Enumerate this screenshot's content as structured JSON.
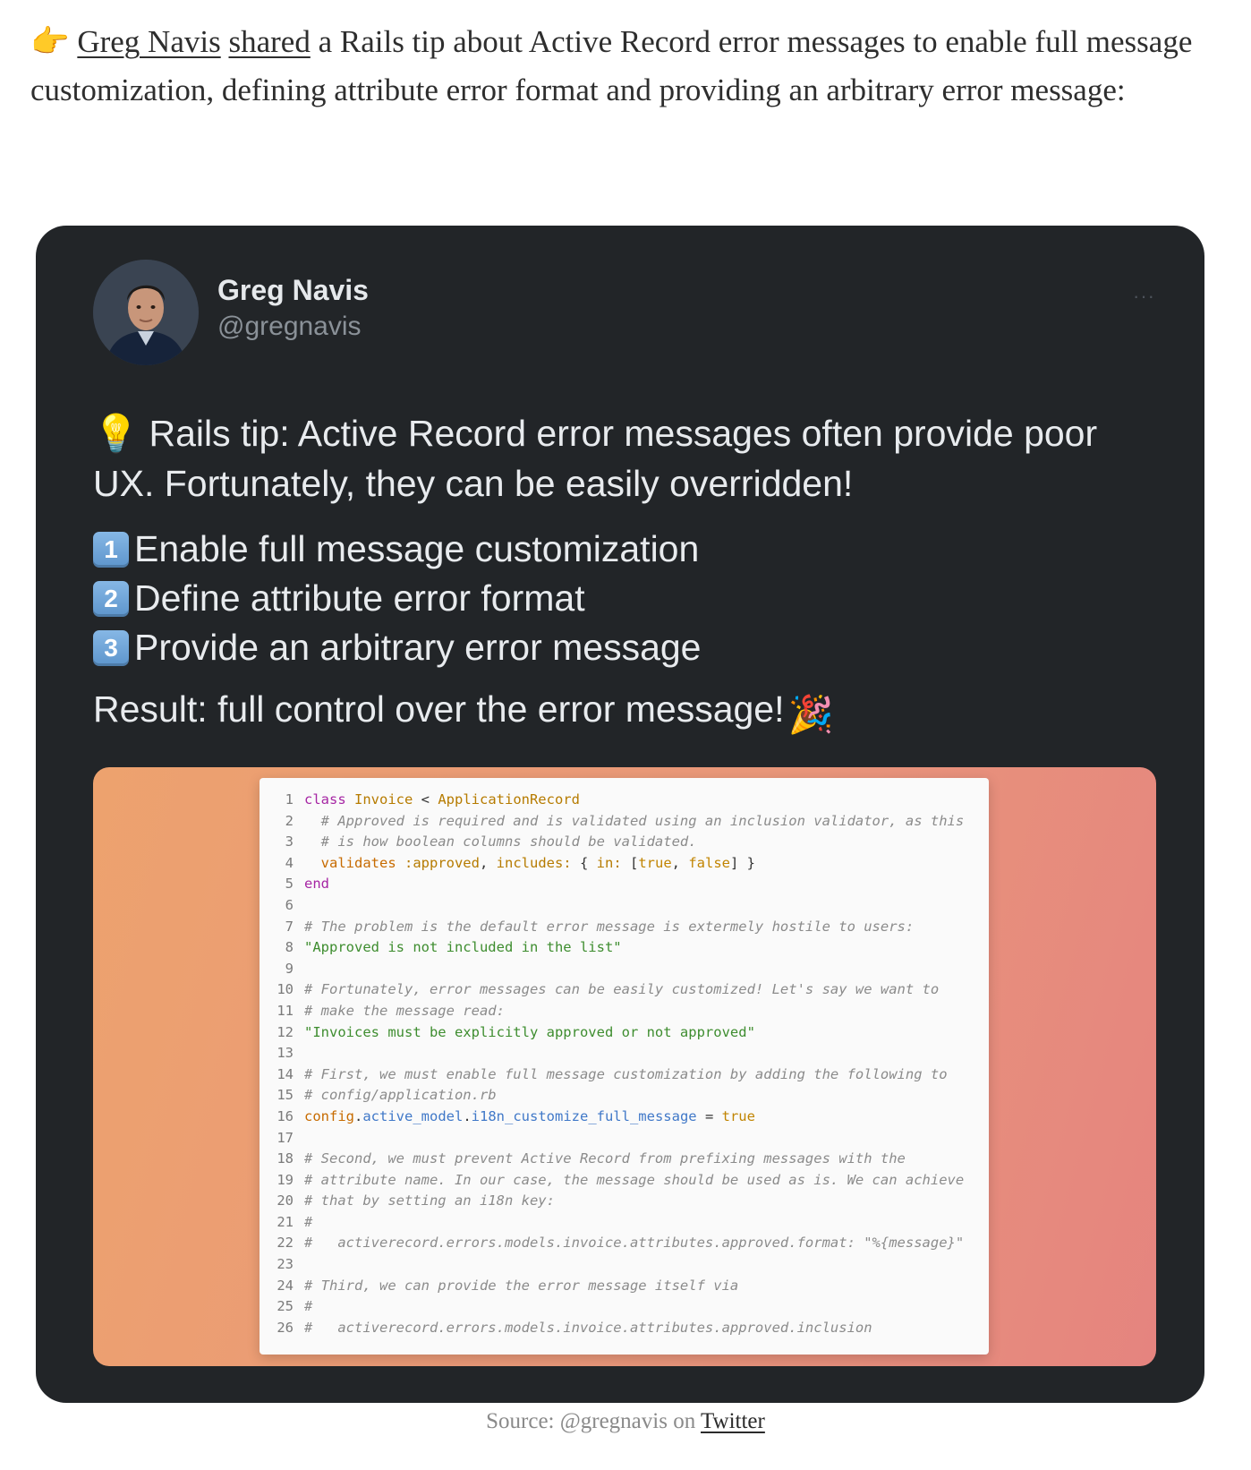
{
  "intro": {
    "pointer_emoji": "👉",
    "author_link": "Greg Navis",
    "space": " ",
    "shared_link": "shared",
    "text": " a Rails tip about Active Record error messages to enable full message customization, defining attribute error format and providing an arbitrary error message:"
  },
  "tweet": {
    "author_name": "Greg Navis",
    "author_handle": "@gregnavis",
    "more_icon": "···",
    "bulb_emoji": "💡",
    "lead": "Rails tip: Active Record error messages often provide poor UX. Fortunately, they can be easily overridden!",
    "steps": [
      {
        "num": "1",
        "label": "Enable full message customization"
      },
      {
        "num": "2",
        "label": "Define attribute error format"
      },
      {
        "num": "3",
        "label": "Provide an arbitrary error message"
      }
    ],
    "result": "Result: full control over the error message!",
    "party_emoji": "🎉",
    "code_lines": [
      {
        "n": "1",
        "parts": [
          [
            "kw",
            "class "
          ],
          [
            "ty",
            "Invoice "
          ],
          [
            "tx",
            "< "
          ],
          [
            "ty",
            "ApplicationRecord"
          ]
        ]
      },
      {
        "n": "2",
        "parts": [
          [
            "cm",
            "  # Approved is required and is validated using an inclusion validator, as this"
          ]
        ]
      },
      {
        "n": "3",
        "parts": [
          [
            "cm",
            "  # is how boolean columns should be validated."
          ]
        ]
      },
      {
        "n": "4",
        "parts": [
          [
            "fn",
            "  validates "
          ],
          [
            "sy",
            ":approved"
          ],
          [
            "tx",
            ", "
          ],
          [
            "sy",
            "includes: "
          ],
          [
            "tx",
            "{ "
          ],
          [
            "sy",
            "in: "
          ],
          [
            "tx",
            "["
          ],
          [
            "rv",
            "true"
          ],
          [
            "tx",
            ", "
          ],
          [
            "rv",
            "false"
          ],
          [
            "tx",
            "] }"
          ]
        ]
      },
      {
        "n": "5",
        "parts": [
          [
            "kw",
            "end"
          ]
        ]
      },
      {
        "n": "6",
        "parts": []
      },
      {
        "n": "7",
        "parts": [
          [
            "cm",
            "# The problem is the default error message is extermely hostile to users:"
          ]
        ]
      },
      {
        "n": "8",
        "parts": [
          [
            "st",
            "\"Approved is not included in the list\""
          ]
        ]
      },
      {
        "n": "9",
        "parts": []
      },
      {
        "n": "10",
        "parts": [
          [
            "cm",
            "# Fortunately, error messages can be easily customized! Let's say we want to"
          ]
        ]
      },
      {
        "n": "11",
        "parts": [
          [
            "cm",
            "# make the message read:"
          ]
        ]
      },
      {
        "n": "12",
        "parts": [
          [
            "st",
            "\"Invoices must be explicitly approved or not approved\""
          ]
        ]
      },
      {
        "n": "13",
        "parts": []
      },
      {
        "n": "14",
        "parts": [
          [
            "cm",
            "# First, we must enable full message customization by adding the following to"
          ]
        ]
      },
      {
        "n": "15",
        "parts": [
          [
            "cm",
            "# config/application.rb"
          ]
        ]
      },
      {
        "n": "16",
        "parts": [
          [
            "fn",
            "config"
          ],
          [
            "tx",
            "."
          ],
          [
            "at",
            "active_model"
          ],
          [
            "tx",
            "."
          ],
          [
            "at",
            "i18n_customize_full_message"
          ],
          [
            "tx",
            " = "
          ],
          [
            "rv",
            "true"
          ]
        ]
      },
      {
        "n": "17",
        "parts": []
      },
      {
        "n": "18",
        "parts": [
          [
            "cm",
            "# Second, we must prevent Active Record from prefixing messages with the"
          ]
        ]
      },
      {
        "n": "19",
        "parts": [
          [
            "cm",
            "# attribute name. In our case, the message should be used as is. We can achieve"
          ]
        ]
      },
      {
        "n": "20",
        "parts": [
          [
            "cm",
            "# that by setting an i18n key:"
          ]
        ]
      },
      {
        "n": "21",
        "parts": [
          [
            "cm",
            "#"
          ]
        ]
      },
      {
        "n": "22",
        "parts": [
          [
            "cm",
            "#   activerecord.errors.models.invoice.attributes.approved.format: \"%{message}\""
          ]
        ]
      },
      {
        "n": "23",
        "parts": []
      },
      {
        "n": "24",
        "parts": [
          [
            "cm",
            "# Third, we can provide the error message itself via"
          ]
        ]
      },
      {
        "n": "25",
        "parts": [
          [
            "cm",
            "#"
          ]
        ]
      },
      {
        "n": "26",
        "parts": [
          [
            "cm",
            "#   activerecord.errors.models.invoice.attributes.approved.inclusion"
          ]
        ]
      }
    ]
  },
  "caption": {
    "text": "Source: @gregnavis on ",
    "link": "Twitter"
  },
  "colors": {
    "card_bg": "#222528",
    "gradient_start": "#eda26e",
    "gradient_end": "#e5847f",
    "keycap": "#6fa3d8"
  }
}
